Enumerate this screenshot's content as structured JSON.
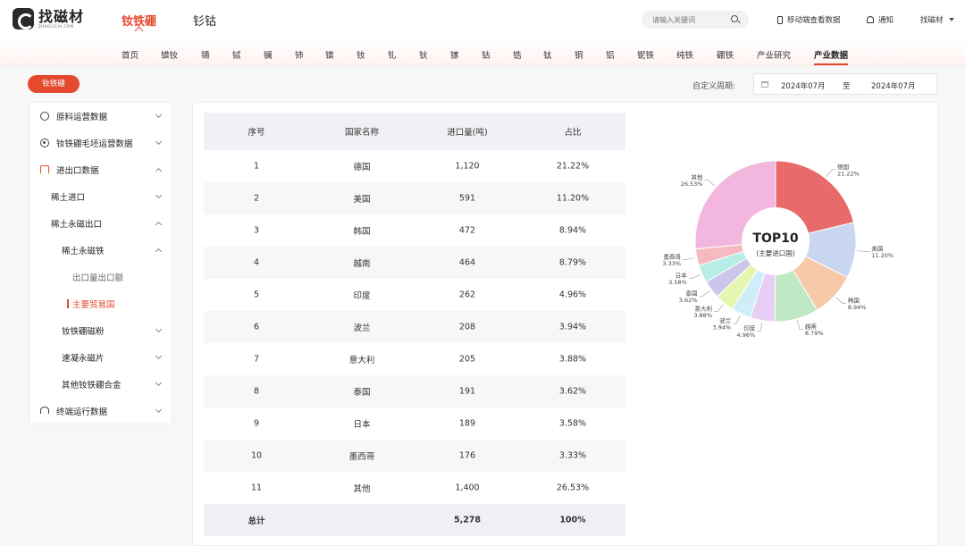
{
  "header": {
    "logo_cn": "找磁材",
    "logo_en": "ZHAOCICAI.COM",
    "tabs": [
      {
        "label": "钕铁硼",
        "active": true
      },
      {
        "label": "钐钴",
        "active": false
      }
    ],
    "search_placeholder": "请输入关键词",
    "mobile_link": "移动端查看数据",
    "notify_label": "通知",
    "user_label": "找磁材"
  },
  "subnav": [
    "首页",
    "镨钕",
    "镝",
    "铽",
    "镧",
    "铈",
    "镨",
    "钕",
    "钆",
    "钬",
    "镓",
    "钴",
    "锆",
    "钛",
    "铜",
    "铝",
    "铌铁",
    "纯铁",
    "硼铁",
    "产业研究",
    "产业数据"
  ],
  "subnav_active": "产业数据",
  "filter": {
    "category_pill": "钕铁硼",
    "period_label": "自定义周期:",
    "date_from": "2024年07月",
    "date_sep": "至",
    "date_to": "2024年07月"
  },
  "sidebar": {
    "items": [
      {
        "label": "原料运营数据",
        "icon": "chart-icon",
        "expanded": false
      },
      {
        "label": "钕铁硼毛坯运营数据",
        "icon": "target-icon",
        "expanded": false
      },
      {
        "label": "进出口数据",
        "icon": "import-export-icon",
        "expanded": true
      },
      {
        "label": "稀土进口",
        "expanded": false
      },
      {
        "label": "稀土永磁出口",
        "expanded": true
      },
      {
        "label": "稀土永磁铁",
        "expanded": true
      },
      {
        "label": "出口量出口额"
      },
      {
        "label": "主要贸易国",
        "active": true
      },
      {
        "label": "钕铁硼磁粉",
        "expanded": false
      },
      {
        "label": "速凝永磁片",
        "expanded": false
      },
      {
        "label": "其他钕铁硼合金",
        "expanded": false
      },
      {
        "label": "终端运行数据",
        "icon": "gauge-icon",
        "expanded": false
      }
    ]
  },
  "table": {
    "headers": [
      "序号",
      "国家名称",
      "进口量(吨)",
      "占比"
    ],
    "rows": [
      [
        "1",
        "德国",
        "1,120",
        "21.22%"
      ],
      [
        "2",
        "美国",
        "591",
        "11.20%"
      ],
      [
        "3",
        "韩国",
        "472",
        "8.94%"
      ],
      [
        "4",
        "越南",
        "464",
        "8.79%"
      ],
      [
        "5",
        "印度",
        "262",
        "4.96%"
      ],
      [
        "6",
        "波兰",
        "208",
        "3.94%"
      ],
      [
        "7",
        "意大利",
        "205",
        "3.88%"
      ],
      [
        "8",
        "泰国",
        "191",
        "3.62%"
      ],
      [
        "9",
        "日本",
        "189",
        "3.58%"
      ],
      [
        "10",
        "墨西哥",
        "176",
        "3.33%"
      ],
      [
        "11",
        "其他",
        "1,400",
        "26.53%"
      ]
    ],
    "total": [
      "总计",
      "",
      "5,278",
      "100%"
    ]
  },
  "chart_data": {
    "type": "pie",
    "center_title": "TOP10",
    "center_subtitle": "(主要进口国)",
    "slices": [
      {
        "name": "德国",
        "value": 21.22,
        "color": "#e86a6a"
      },
      {
        "name": "美国",
        "value": 11.2,
        "color": "#c9d6f2"
      },
      {
        "name": "韩国",
        "value": 8.94,
        "color": "#f8c9a8"
      },
      {
        "name": "越南",
        "value": 8.79,
        "color": "#bfe9c4"
      },
      {
        "name": "印度",
        "value": 4.96,
        "color": "#e8cdf5"
      },
      {
        "name": "波兰",
        "value": 3.94,
        "color": "#cdeef8"
      },
      {
        "name": "意大利",
        "value": 3.88,
        "color": "#e6f5b0"
      },
      {
        "name": "泰国",
        "value": 3.62,
        "color": "#cbc7ea"
      },
      {
        "name": "日本",
        "value": 3.58,
        "color": "#b6ede6"
      },
      {
        "name": "墨西哥",
        "value": 3.33,
        "color": "#f7b9c0"
      },
      {
        "name": "其他",
        "value": 26.53,
        "color": "#f2b6df"
      }
    ],
    "labels": [
      "21.22%",
      "11.20%",
      "8.94%",
      "8.79%",
      "4.96%",
      "3.94%",
      "3.88%",
      "3.62%",
      "3.58%",
      "3.33%",
      "26.53%"
    ]
  }
}
